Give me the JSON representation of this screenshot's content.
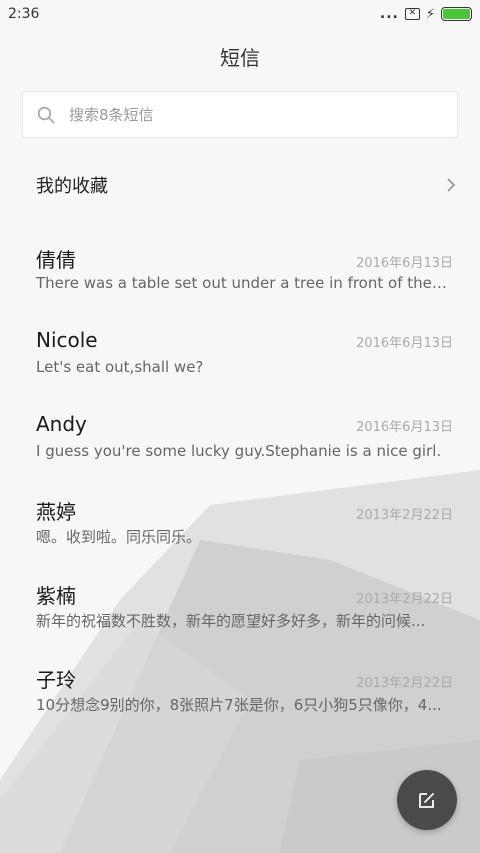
{
  "status_bar": {
    "time": "2:36",
    "dots": "...",
    "sim_label": "✕",
    "battery_level": 1.0
  },
  "header": {
    "title": "短信"
  },
  "search": {
    "placeholder": "搜索8条短信"
  },
  "favorites": {
    "label": "我的收藏"
  },
  "messages": [
    {
      "name": "倩倩",
      "date": "2016年6月13日",
      "preview": "There was a table set out under a tree in front of the ho..."
    },
    {
      "name": "Nicole",
      "date": "2016年6月13日",
      "preview": "Let's eat out,shall we?"
    },
    {
      "name": "Andy",
      "date": "2016年6月13日",
      "preview": "I guess you're some lucky guy.Stephanie is a nice girl."
    },
    {
      "name": "燕婷",
      "date": "2013年2月22日",
      "preview": "嗯。收到啦。同乐同乐。"
    },
    {
      "name": "紫楠",
      "date": "2013年2月22日",
      "preview": "新年的祝福数不胜数，新年的愿望好多好多，新年的问候..."
    },
    {
      "name": "子玲",
      "date": "2013年2月22日",
      "preview": "10分想念9别的你，8张照片7张是你，6只小狗5只像你，4..."
    }
  ],
  "colors": {
    "battery": "#4bc43b",
    "fab": "#4a4a4a"
  },
  "icons": {
    "search": "search-icon",
    "chevron": "chevron-right-icon",
    "compose": "compose-icon",
    "bolt": "charging-bolt-icon"
  }
}
